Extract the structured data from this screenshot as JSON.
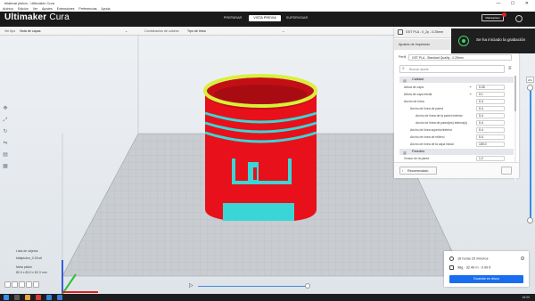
{
  "window": {
    "title": "bilateral pistón - Ultimaker Cura",
    "controls": "—  ☐  ✕"
  },
  "menu": [
    "Archivo",
    "Edición",
    "Ver",
    "Ajustes",
    "Extensiones",
    "Preferencias",
    "Ayuda"
  ],
  "header": {
    "logo_main": "Ultimaker",
    "logo_sub": "Cura",
    "stages": [
      "PREPARAR",
      "VISTA PREVIA",
      "SUPERVISAR"
    ],
    "active_stage": "VISTA PREVIA",
    "marketplace": "Marketplace"
  },
  "view_toolbar": {
    "view_type_label": "Ver tipo",
    "view_type_value": "Vista de capas",
    "color_scheme_label": "Combinación de colores",
    "color_scheme_value": "Tipo de línea"
  },
  "print_settings": {
    "header_text": "GST PLA - 0_2p - 0.25mm",
    "title": "Ajustes de impresión",
    "profile_label": "Perfil",
    "profile_value": "GST PLA - Standard Quality - 0.25mm",
    "search_placeholder": "Buscar ajuste",
    "sections": {
      "quality": "Calidad",
      "walls": "Paredes"
    },
    "quality_settings": [
      {
        "label": "Altura de capa",
        "value": "0.25"
      },
      {
        "label": "Altura de capa inicial",
        "value": "0.1"
      },
      {
        "label": "Ancho de línea",
        "value": "0.4"
      },
      {
        "label": "Ancho de línea de pared",
        "value": "0.4"
      },
      {
        "label": "Ancho de línea de la pared exterior",
        "value": "0.4"
      },
      {
        "label": "Ancho de línea de pared(es) interna(s)",
        "value": "0.4"
      },
      {
        "label": "Ancho de línea superior/inferior",
        "value": "0.4"
      },
      {
        "label": "Ancho de línea de relleno",
        "value": "0.4"
      },
      {
        "label": "Ancho de línea de la capa inicial",
        "value": "100.0"
      }
    ],
    "walls_settings": [
      {
        "label": "Grosor de la pared",
        "value": "1.2"
      }
    ],
    "recommended_button": "Recomendado"
  },
  "toast": {
    "text": "Se ha iniciado la grabación"
  },
  "layer_slider": {
    "current_layer": "241"
  },
  "object_list": {
    "title": "Lista de objetos",
    "file": "bilatpistón_0.25.stl",
    "name": "Meta pistón",
    "dimensions": "80.0 x 80.0 x 82.3 mm"
  },
  "action_panel": {
    "time": "16 horas 20 minutos",
    "material": "98g · 32.49 m · 0.99 €",
    "save_button": "Guardar en disco"
  },
  "taskbar": {
    "clock": "16:00"
  },
  "colors": {
    "accent": "#196ef0",
    "model_red": "#e8101a",
    "model_cyan": "#3ad6d6",
    "model_yellow": "#d8f03a",
    "header_bg": "#1a1a1a"
  }
}
